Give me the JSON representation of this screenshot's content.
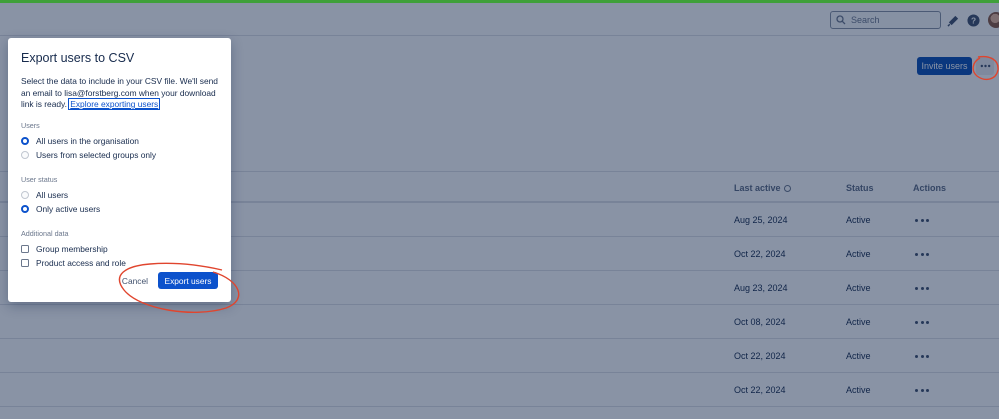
{
  "topnav": {
    "search_placeholder": "Search"
  },
  "page": {
    "invite_label": "Invite users"
  },
  "table": {
    "headers": {
      "last_active": "Last active",
      "status": "Status",
      "actions": "Actions"
    },
    "rows": [
      {
        "last_active": "Aug 25, 2024",
        "status": "Active"
      },
      {
        "last_active": "Oct 22, 2024",
        "status": "Active"
      },
      {
        "last_active": "Aug 23, 2024",
        "status": "Active"
      },
      {
        "last_active": "Oct 08, 2024",
        "status": "Active"
      },
      {
        "last_active": "Oct 22, 2024",
        "status": "Active"
      },
      {
        "last_active": "Oct 22, 2024",
        "status": "Active"
      }
    ]
  },
  "modal": {
    "title": "Export users to CSV",
    "description_pre": "Select the data to include in your CSV file. We'll send an email to lisa@forstberg.com when your download link is ready.",
    "description_link": "Explore exporting users",
    "users_label": "Users",
    "users_options": [
      "All users in the organisation",
      "Users from selected groups only"
    ],
    "status_label": "User status",
    "status_options": [
      "All users",
      "Only active users"
    ],
    "additional_label": "Additional data",
    "additional_options": [
      "Group membership",
      "Product access and role"
    ],
    "cancel_label": "Cancel",
    "export_label": "Export users"
  },
  "colors": {
    "accent_bar": "#3fa03a",
    "primary": "#0c52cc",
    "annotation": "#e0452e"
  },
  "icons": [
    "search-icon",
    "notification-icon",
    "help-icon",
    "more-icon",
    "info-icon"
  ]
}
